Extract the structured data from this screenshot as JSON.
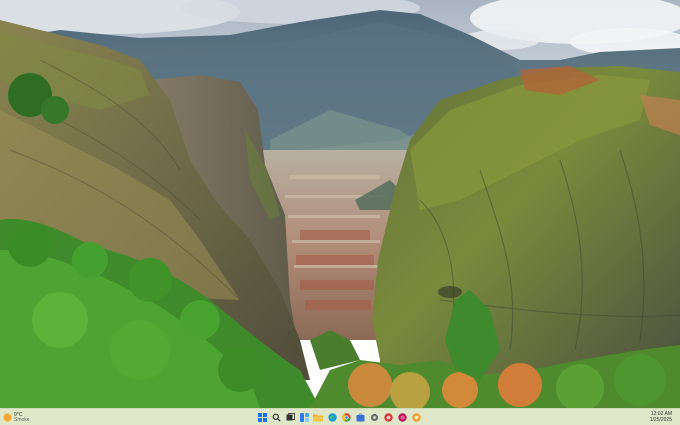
{
  "taskbar": {
    "weather": {
      "temp": "9°C",
      "condition": "Smoke"
    },
    "clock": {
      "time": "12:02 AM",
      "date": "1/25/2025"
    },
    "apps": [
      {
        "name": "start-icon",
        "color": "#1a73e8"
      },
      {
        "name": "search-icon",
        "color": "#333333"
      },
      {
        "name": "task-view-icon",
        "color": "#333333"
      },
      {
        "name": "widgets-icon",
        "color": "#2b7de9"
      },
      {
        "name": "file-explorer-icon",
        "color": "#e8b43a"
      },
      {
        "name": "edge-icon",
        "color": "#1c9bd7"
      },
      {
        "name": "chrome-icon",
        "color": "#e34133"
      },
      {
        "name": "store-icon",
        "color": "#3a6fd8"
      },
      {
        "name": "settings-icon",
        "color": "#6b6b6b"
      },
      {
        "name": "app-icon",
        "color": "#d93a3a"
      },
      {
        "name": "app-icon-2",
        "color": "#c2185b"
      },
      {
        "name": "app-icon-3",
        "color": "#f29d2a"
      }
    ]
  }
}
